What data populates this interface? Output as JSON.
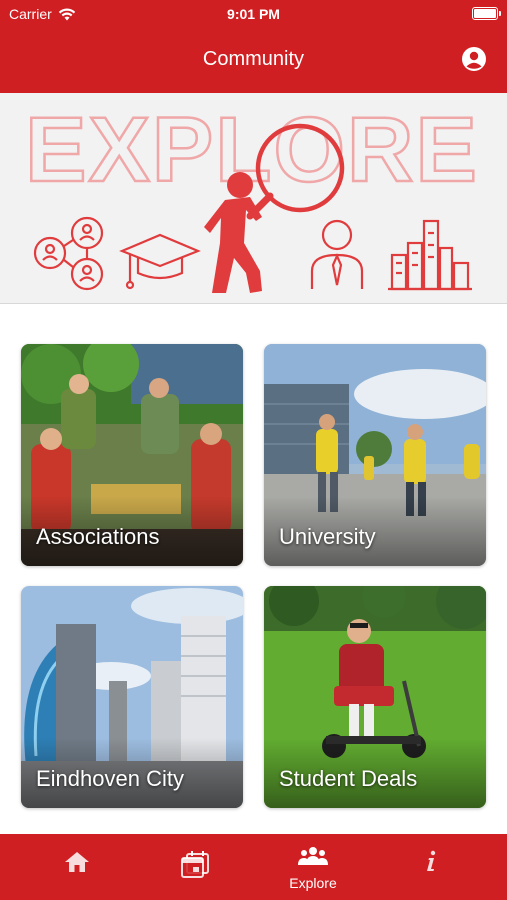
{
  "status": {
    "carrier": "Carrier",
    "time": "9:01 PM"
  },
  "navbar": {
    "title": "Community"
  },
  "banner": {
    "headline": "EXPLORE"
  },
  "tiles": [
    {
      "label": "Associations"
    },
    {
      "label": "University"
    },
    {
      "label": "Eindhoven City"
    },
    {
      "label": "Student Deals"
    }
  ],
  "tabbar": {
    "items": [
      {
        "icon": "home-icon",
        "label": ""
      },
      {
        "icon": "calendar-icon",
        "label": ""
      },
      {
        "icon": "people-icon",
        "label": "Explore"
      },
      {
        "icon": "info-icon",
        "label": ""
      }
    ]
  },
  "colors": {
    "brand": "#cf1f22",
    "background": "#f2f2f2"
  }
}
